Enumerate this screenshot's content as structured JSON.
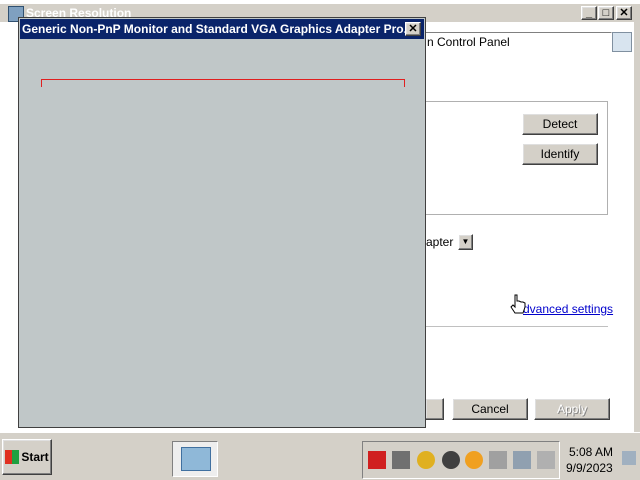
{
  "bg_window": {
    "title": "Screen Resolution",
    "address": "n Control Panel",
    "detect_label": "Detect",
    "identify_label": "Identify",
    "adapter_select": "apter",
    "advanced_link": "dvanced settings",
    "apply_prefix_label": "",
    "cancel_label": "Cancel",
    "apply_label": "Apply"
  },
  "fg_window": {
    "title": "Generic Non-PnP Monitor and Standard VGA Graphics Adapter Pro...",
    "close_label": "✕"
  },
  "taskbar": {
    "start_label": "Start",
    "clock_time": "5:08 AM",
    "clock_date": "9/9/2023"
  },
  "colors": {
    "title_active": "#0a246a",
    "face": "#d4d0c8",
    "fg_body": "#c0c7c8",
    "taskbar": "#d4d0c8"
  }
}
